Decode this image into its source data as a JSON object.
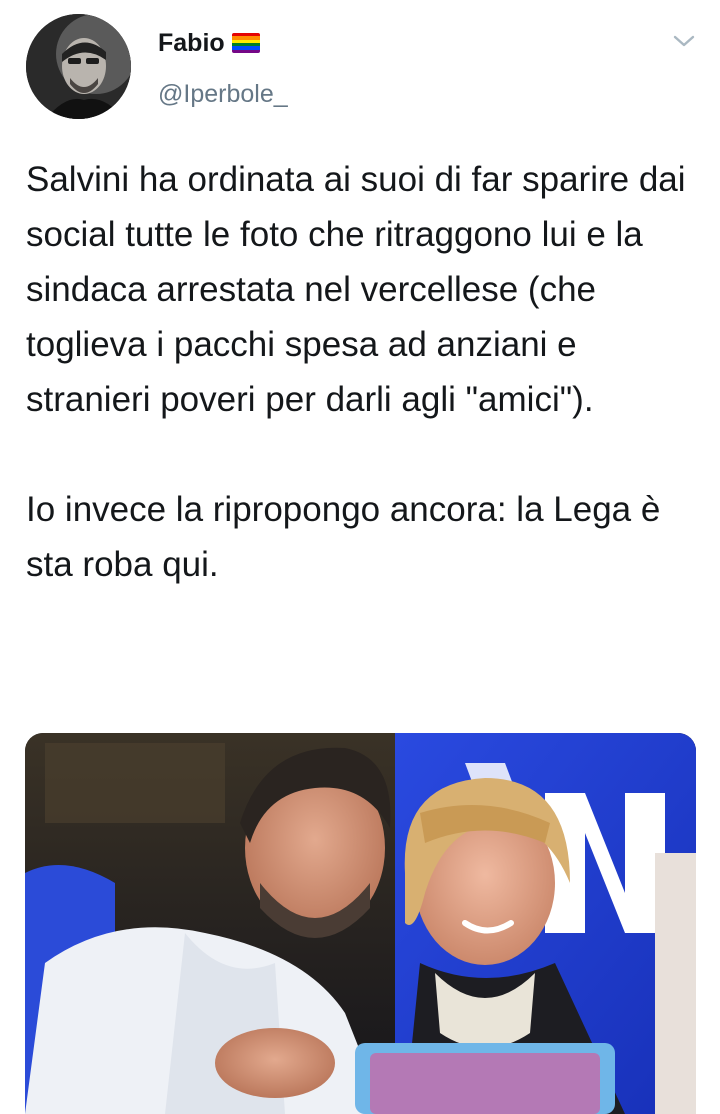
{
  "author": {
    "display_name": "Fabio",
    "handle": "@Iperbole_",
    "name_badge_icon": "rainbow-flag-icon",
    "flag_colors": [
      "#e40303",
      "#ff8c00",
      "#ffed00",
      "#008026",
      "#004dff",
      "#750787"
    ]
  },
  "menu": {
    "icon": "chevron-down-icon"
  },
  "tweet": {
    "paragraph_1": "Salvini ha ordinata ai suoi di far sparire dai social tutte le foto che ritraggono lui e la sindaca arrestata nel vercellese (che toglieva i pacchi spesa ad anziani e stranieri poveri per darli agli \"amici\").",
    "paragraph_2": "Io invece la ripropongo ancora: la Lega è sta roba qui."
  },
  "colors": {
    "text": "#14171a",
    "secondary_text": "#657786",
    "banner_blue": "#1f3fd4"
  }
}
